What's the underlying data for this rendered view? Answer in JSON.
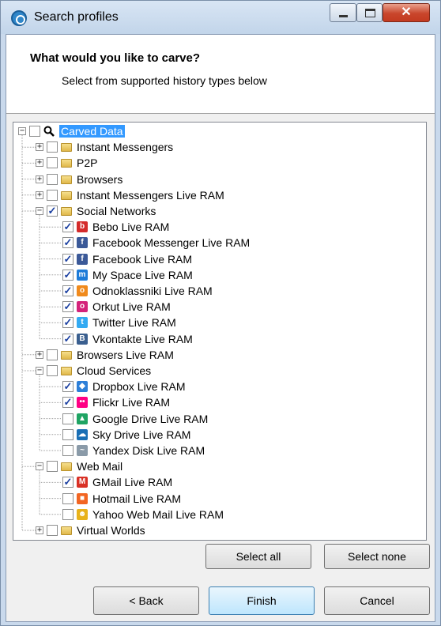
{
  "window": {
    "title": "Search profiles"
  },
  "header": {
    "question": "What would you like to carve?",
    "subtitle": "Select from supported history types below"
  },
  "tree": [
    {
      "label": "Carved Data",
      "depth": 0,
      "expander": "minus",
      "checked": false,
      "icon": "magnifier-icon",
      "selected": true
    },
    {
      "label": "Instant Messengers",
      "depth": 1,
      "expander": "plus",
      "checked": false,
      "icon": "folder-icon"
    },
    {
      "label": "P2P",
      "depth": 1,
      "expander": "plus",
      "checked": false,
      "icon": "folder-icon"
    },
    {
      "label": "Browsers",
      "depth": 1,
      "expander": "plus",
      "checked": false,
      "icon": "folder-icon"
    },
    {
      "label": "Instant Messengers Live RAM",
      "depth": 1,
      "expander": "plus",
      "checked": false,
      "icon": "folder-icon"
    },
    {
      "label": "Social Networks",
      "depth": 1,
      "expander": "minus",
      "checked": true,
      "icon": "folder-icon"
    },
    {
      "label": "Bebo Live RAM",
      "depth": 2,
      "checked": true,
      "icon": "bebo-icon",
      "color": "#d42b2b"
    },
    {
      "label": "Facebook Messenger Live RAM",
      "depth": 2,
      "checked": true,
      "icon": "facebook-icon",
      "color": "#3b5998"
    },
    {
      "label": "Facebook Live RAM",
      "depth": 2,
      "checked": true,
      "icon": "facebook-icon",
      "color": "#3b5998"
    },
    {
      "label": "My Space Live RAM",
      "depth": 2,
      "checked": true,
      "icon": "myspace-icon",
      "color": "#1d7bd8"
    },
    {
      "label": "Odnoklassniki Live RAM",
      "depth": 2,
      "checked": true,
      "icon": "odnoklassniki-icon",
      "color": "#f08a1c"
    },
    {
      "label": "Orkut Live RAM",
      "depth": 2,
      "checked": true,
      "icon": "orkut-icon",
      "color": "#d4237a"
    },
    {
      "label": "Twitter Live RAM",
      "depth": 2,
      "checked": true,
      "icon": "twitter-icon",
      "color": "#33aaf2"
    },
    {
      "label": "Vkontakte Live RAM",
      "depth": 2,
      "checked": true,
      "icon": "vkontakte-icon",
      "color": "#3a5f8f"
    },
    {
      "label": "Browsers Live RAM",
      "depth": 1,
      "expander": "plus",
      "checked": false,
      "icon": "folder-icon"
    },
    {
      "label": "Cloud Services",
      "depth": 1,
      "expander": "minus",
      "checked": false,
      "icon": "folder-icon"
    },
    {
      "label": "Dropbox Live RAM",
      "depth": 2,
      "checked": true,
      "icon": "dropbox-icon",
      "color": "#2d7fd8"
    },
    {
      "label": "Flickr Live RAM",
      "depth": 2,
      "checked": true,
      "icon": "flickr-icon",
      "color": "#ff0084"
    },
    {
      "label": "Google Drive Live RAM",
      "depth": 2,
      "checked": false,
      "icon": "google-drive-icon",
      "color": "#1fa463"
    },
    {
      "label": "Sky Drive Live RAM",
      "depth": 2,
      "checked": false,
      "icon": "skydrive-icon",
      "color": "#1a6fb5"
    },
    {
      "label": "Yandex Disk Live RAM",
      "depth": 2,
      "checked": false,
      "icon": "yandex-disk-icon",
      "color": "#8a9aa8"
    },
    {
      "label": "Web Mail",
      "depth": 1,
      "expander": "minus",
      "checked": false,
      "icon": "folder-icon"
    },
    {
      "label": "GMail Live RAM",
      "depth": 2,
      "checked": true,
      "icon": "gmail-icon",
      "color": "#d93025"
    },
    {
      "label": "Hotmail Live RAM",
      "depth": 2,
      "checked": false,
      "icon": "hotmail-icon",
      "color": "#f26522"
    },
    {
      "label": "Yahoo Web Mail Live RAM",
      "depth": 2,
      "checked": false,
      "icon": "yahoo-icon",
      "color": "#e8b21a"
    },
    {
      "label": "Virtual Worlds",
      "depth": 1,
      "expander": "plus",
      "checked": false,
      "icon": "folder-icon"
    }
  ],
  "buttons": {
    "select_all": "Select all",
    "select_none": "Select none",
    "back": "< Back",
    "finish": "Finish",
    "cancel": "Cancel"
  },
  "colors": {
    "selection": "#3399ff",
    "check": "#1a3fa0",
    "title_bar": "#c9d9ec",
    "close_button": "#c9462c"
  }
}
